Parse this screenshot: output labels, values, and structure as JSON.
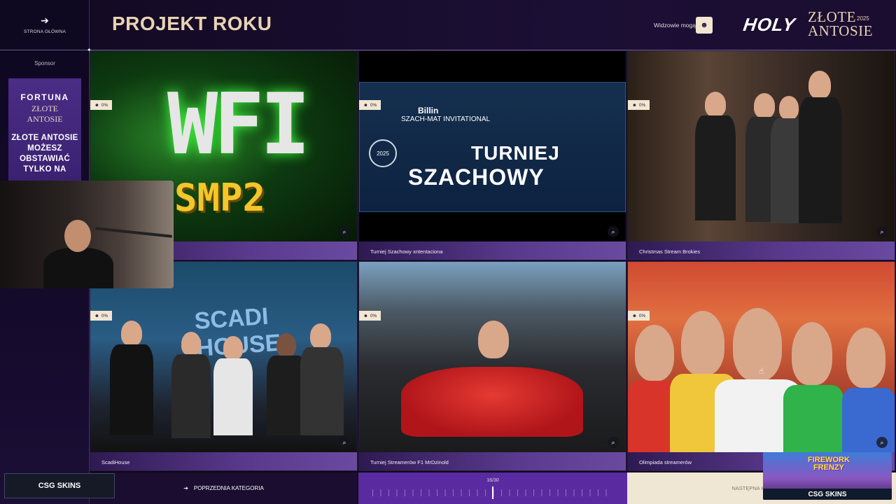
{
  "sidebar": {
    "home_label": "STRONA GŁÓWNA",
    "sponsor_label": "Sponsor",
    "sponsor_card": {
      "brand": "FORTUNA",
      "event_line1": "ZŁOTE",
      "event_line2": "ANTOSIE",
      "promo_line1": "ZŁOTE ANTOSIE",
      "promo_line2": "MOŻESZ",
      "promo_line3": "OBSTAWIAĆ",
      "promo_line4": "TYLKO NA"
    }
  },
  "header": {
    "title": "PROJEKT ROKU",
    "viewers_label": "Widzowie mogą",
    "logo_holy": "HOLY",
    "logo_zlote": "ZŁOTE",
    "logo_antosie": "ANTOSIE",
    "logo_year": "2025"
  },
  "tiles": [
    {
      "caption": "",
      "badge": "0%",
      "art_text1": "WFI",
      "art_text2": "SMP2"
    },
    {
      "caption": "Turniej Szachowy xntentaciona",
      "badge": "0%",
      "art_text1": "Billin",
      "art_text2": "SZACH-MAT INVITATIONAL",
      "art_text3": "TURNIEJ",
      "art_text4": "SZACHOWY",
      "art_text5": "2025"
    },
    {
      "caption": "Christmas Stream Brokies",
      "badge": "0%"
    },
    {
      "caption": "ScadiHouse",
      "badge": "0%",
      "art_text1": "SCADI HOUSE"
    },
    {
      "caption": "Turniej Streamerów F1 MrDzinold",
      "badge": "0%"
    },
    {
      "caption": "Olimpiada streamerów",
      "badge": "0%"
    }
  ],
  "footer": {
    "prev_label": "POPRZEDNIA KATEGORIA",
    "progress_text": "16/30",
    "progress_fraction": 0.5,
    "next_label": "NASTĘPNA KATEGORIA"
  },
  "overlays": {
    "csg_left": "CSG SKINS",
    "csg_right": "CSG SKINS",
    "firework_line1": "FIREWORK",
    "firework_line2": "FRENZY"
  },
  "colors": {
    "title": "#e9d3b3",
    "progress_bg": "#5a2aa0",
    "badge_bg": "#f1e7d2"
  }
}
